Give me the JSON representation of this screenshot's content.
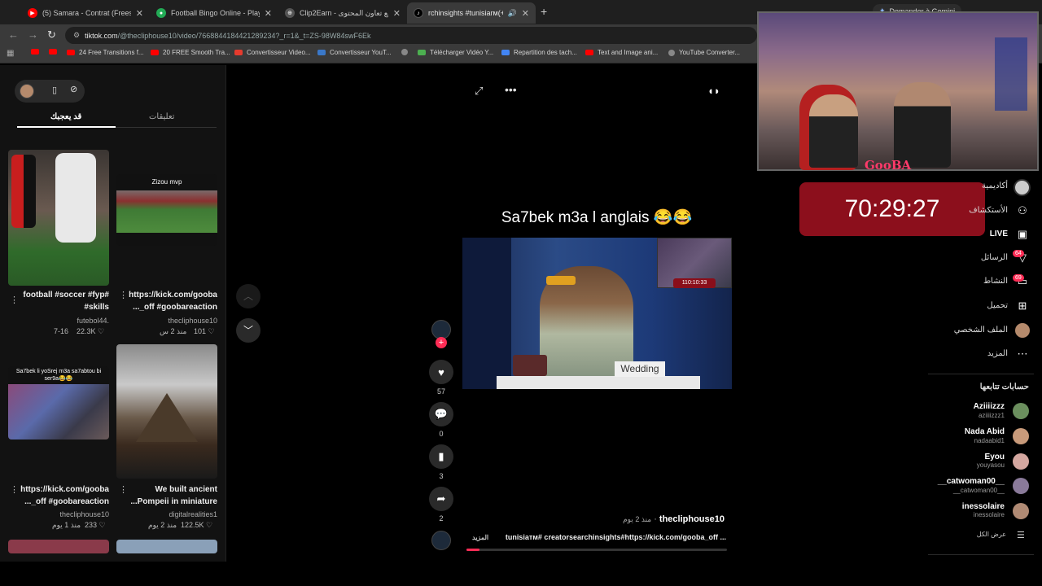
{
  "browser": {
    "tabs": [
      {
        "title": "(5) Samara - Contrat (Freestyle",
        "icon": "youtube-icon",
        "color": "#ff0000"
      },
      {
        "title": "Football Bingo Online - Play N",
        "icon": "football-icon",
        "color": "#22aa55"
      },
      {
        "title": "Clip2Earn - تسريع تعاون المحتوى",
        "icon": "clip-icon",
        "color": "#666666"
      },
      {
        "title": "rchinsights #tunisiarм(+99)",
        "icon": "tiktok-icon",
        "color": "#111111"
      }
    ],
    "new_tab": "+",
    "url_host": "tiktok.com",
    "url_path": "/@thecliphouse10/video/7668844184421289234?_r=1&_t=ZS-98W84swF6Ek",
    "gemini_button": "Demander à Gemini",
    "bookmarks": [
      {
        "label": "",
        "color": "#ff0000"
      },
      {
        "label": "",
        "color": "#ff0000"
      },
      {
        "label": "24 Free Transitions f...",
        "color": "#ff0000"
      },
      {
        "label": "20 FREE Smooth Tra...",
        "color": "#ff0000"
      },
      {
        "label": "Convertisseur Video...",
        "color": "#e63b2e"
      },
      {
        "label": "Convertisseur YouT...",
        "color": "#3a78c9"
      },
      {
        "label": "",
        "color": "#888888"
      },
      {
        "label": "Télécharger Vidéo Y...",
        "color": "#4caf50"
      },
      {
        "label": "Repartition des tach...",
        "color": "#4285f4"
      },
      {
        "label": "Text and Image ani...",
        "color": "#ff0000"
      },
      {
        "label": "YouTube Converter...",
        "color": "#888888"
      }
    ]
  },
  "left_panel": {
    "tab_comments": "تعليقات",
    "tab_you_may_like": "قد يعجبك",
    "videos": [
      {
        "caption1": "football #soccer #fyp#",
        "caption2": "#skills",
        "author": "futebol44.",
        "date": "7-16",
        "likes": "22.3K",
        "overlay": ""
      },
      {
        "caption1": "https://kick.com/gooba",
        "caption2": "..._off #goobareaction",
        "author": "thecliphouse10",
        "date": "منذ 2 س",
        "likes": "101",
        "overlay": "Zizou mvp"
      },
      {
        "caption1": "https://kick.com/gooba",
        "caption2": "..._off #goobareaction",
        "author": "thecliphouse10",
        "date": "منذ 1 يوم",
        "likes": "233",
        "overlay": "Sa7bek li yoSrej m3a sa7abtou bi ser9a😂😂"
      },
      {
        "caption1": "We built ancient",
        "caption2": "...Pompeii in miniature",
        "author": "digitalrealities1",
        "date": "منذ 2 يوم",
        "likes": "122.5K",
        "overlay": ""
      }
    ]
  },
  "video": {
    "title": "Sa7bek m3a l anglais 😂😂",
    "overlay_label": "Wedding",
    "timer_in_video": "110:10:33",
    "likes": "57",
    "comments": "0",
    "saves": "3",
    "shares": "2",
    "author": "thecliphouse10",
    "posted": "منذ 2 يوم",
    "description": "tunisiaтм# creatorsearchinsights#https://kick.com/gooba_off ...",
    "more": "المزيد",
    "progress": 0.05
  },
  "stream_overlay": {
    "channel_logo": "GooBA",
    "timer": "70:29:27"
  },
  "right_nav": {
    "items": [
      {
        "label": "أكاديمية",
        "icon": "academy-icon",
        "bold": false
      },
      {
        "label": "الأستكشاف",
        "icon": "people-icon",
        "bold": false
      },
      {
        "label": "LIVE",
        "icon": "live-icon",
        "bold": true
      },
      {
        "label": "الرسائل",
        "icon": "messages-icon",
        "bold": false,
        "badge": "64"
      },
      {
        "label": "النشاط",
        "icon": "activity-icon",
        "bold": false,
        "badge": "69"
      },
      {
        "label": "تحميل",
        "icon": "upload-icon",
        "bold": false
      },
      {
        "label": "الملف الشخصي",
        "icon": "profile-icon",
        "bold": false
      },
      {
        "label": "المزيد",
        "icon": "more-icon",
        "bold": false
      }
    ],
    "following_title": "حسابات تتابعها",
    "following": [
      {
        "name": "Aziiiizzz",
        "user": "aziiiizzz1",
        "color": "#6b8f5e"
      },
      {
        "name": "Nada Abid",
        "user": "nadaabid1",
        "color": "#c89a7a"
      },
      {
        "name": "Eyou",
        "user": "youyasou",
        "color": "#d4a7a0"
      },
      {
        "name": "__catwoman00__",
        "user": "__catwoman00__",
        "color": "#8a7a9a"
      },
      {
        "name": "inessolaire",
        "user": "inessolaire",
        "color": "#b08a74"
      }
    ],
    "show_all": "عرض الكل"
  }
}
